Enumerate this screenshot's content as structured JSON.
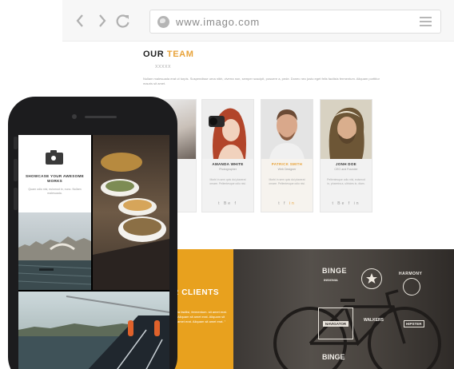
{
  "browser": {
    "url": "www.imago.com",
    "back_icon": "chevron-left-icon",
    "forward_icon": "chevron-right-icon",
    "reload_icon": "reload-icon",
    "globe_icon": "globe-icon",
    "menu_icon": "menu-icon"
  },
  "team": {
    "title_part1": "OUR",
    "title_part2": "TEAM",
    "dots": "xxxxx",
    "intro": "Nullam malesuada erat ut turpis. Suspendisse urna nibh, viverra non, semper suscipit, posuere a, pede. Donec nec justo eget felis facilisis fermentum. Aliquam porttitor mauris sit amet.",
    "members": [
      {
        "name": "AMANDA WHITE",
        "role": "Photographer",
        "desc": "Morbi in sem quis dui placerat ornare. Pellentesque odio nisi.",
        "social": [
          "t",
          "Be",
          "f"
        ]
      },
      {
        "name": "PATRICK SMITH",
        "role": "Web Designer",
        "desc": "Morbi in sem quis dui placerat ornare. Pellentesque odio nisi.",
        "social": [
          "t",
          "f",
          "in"
        ]
      },
      {
        "name": "JONH DOE",
        "role": "CEO and Founder",
        "desc": "Pellentesque odio nisi, euismod in, pharetra a, ultricies in, diam.",
        "social": [
          "t",
          "Be",
          "f",
          "in"
        ]
      }
    ]
  },
  "clients": {
    "title": "R CLIENTS",
    "text": "ia facilisi, fermentum. sit amet erat. Aliquam sit amet erat. Aliquam sit amet erat. Aliquam sit amet erat. \"",
    "logos": [
      "BINGE",
      "INSIGNIA",
      "HARMONY",
      "NAVIGATOR",
      "WALKERS",
      "HIPSTER",
      "BINGE"
    ]
  },
  "phone": {
    "showcase_title": "SHOWCASE YOUR AWESOME WORKS",
    "showcase_text": "Quam odio nisi, euismod in, nunc. Nullam malesuada.",
    "camera_icon": "camera-icon"
  },
  "colors": {
    "accent": "#e8a33a",
    "clients_orange": "#e8a11e",
    "phone_body": "#1c1c1e"
  }
}
